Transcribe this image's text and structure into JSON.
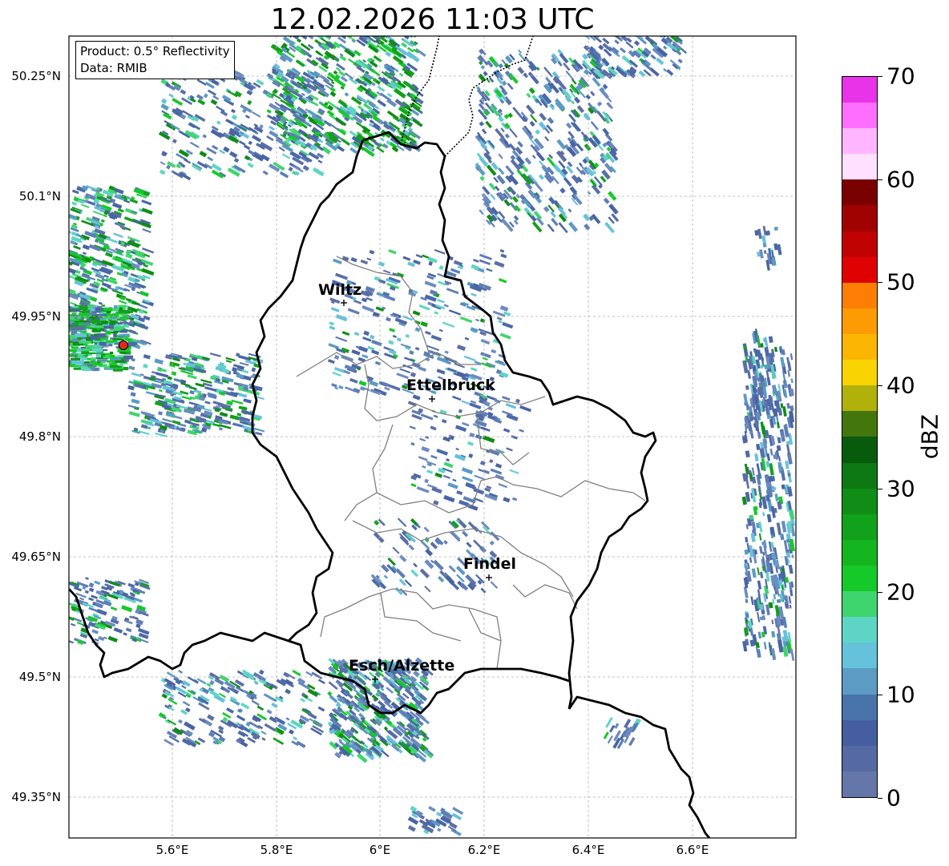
{
  "title": "12.02.2026 11:03 UTC",
  "info_box": {
    "product": "Product: 0.5° Reflectivity",
    "data": "Data: RMIB"
  },
  "map": {
    "lat_labels": [
      "50.25°N",
      "50.1°N",
      "49.95°N",
      "49.8°N",
      "49.65°N",
      "49.5°N",
      "49.35°N"
    ],
    "lon_labels": [
      "5.6°E",
      "5.8°E",
      "6°E",
      "6.2°E",
      "6.4°E",
      "6.6°E"
    ],
    "cities": [
      {
        "name": "Wiltz"
      },
      {
        "name": "Ettelbruck"
      },
      {
        "name": "Findel"
      },
      {
        "name": "Esch/Alzette"
      }
    ],
    "radar_site_marker_color": "#e32a1a"
  },
  "colorbar": {
    "label": "dBZ",
    "ticks": [
      "0",
      "10",
      "20",
      "30",
      "40",
      "50",
      "60",
      "70"
    ],
    "colors": [
      "#6577a8",
      "#556aa2",
      "#445e9f",
      "#4873ab",
      "#5b9bc4",
      "#66c2da",
      "#5ed5c4",
      "#3fd56e",
      "#16c92a",
      "#14b51e",
      "#12a11a",
      "#0f8d16",
      "#0c7912",
      "#085b0d",
      "#44760e",
      "#b0b10a",
      "#f9d402",
      "#fcb502",
      "#fc9b02",
      "#fc7e02",
      "#e00202",
      "#c00202",
      "#a00202",
      "#7a0000",
      "#ffe0ff",
      "#ffb5ff",
      "#ff6eff",
      "#e833e8"
    ]
  }
}
